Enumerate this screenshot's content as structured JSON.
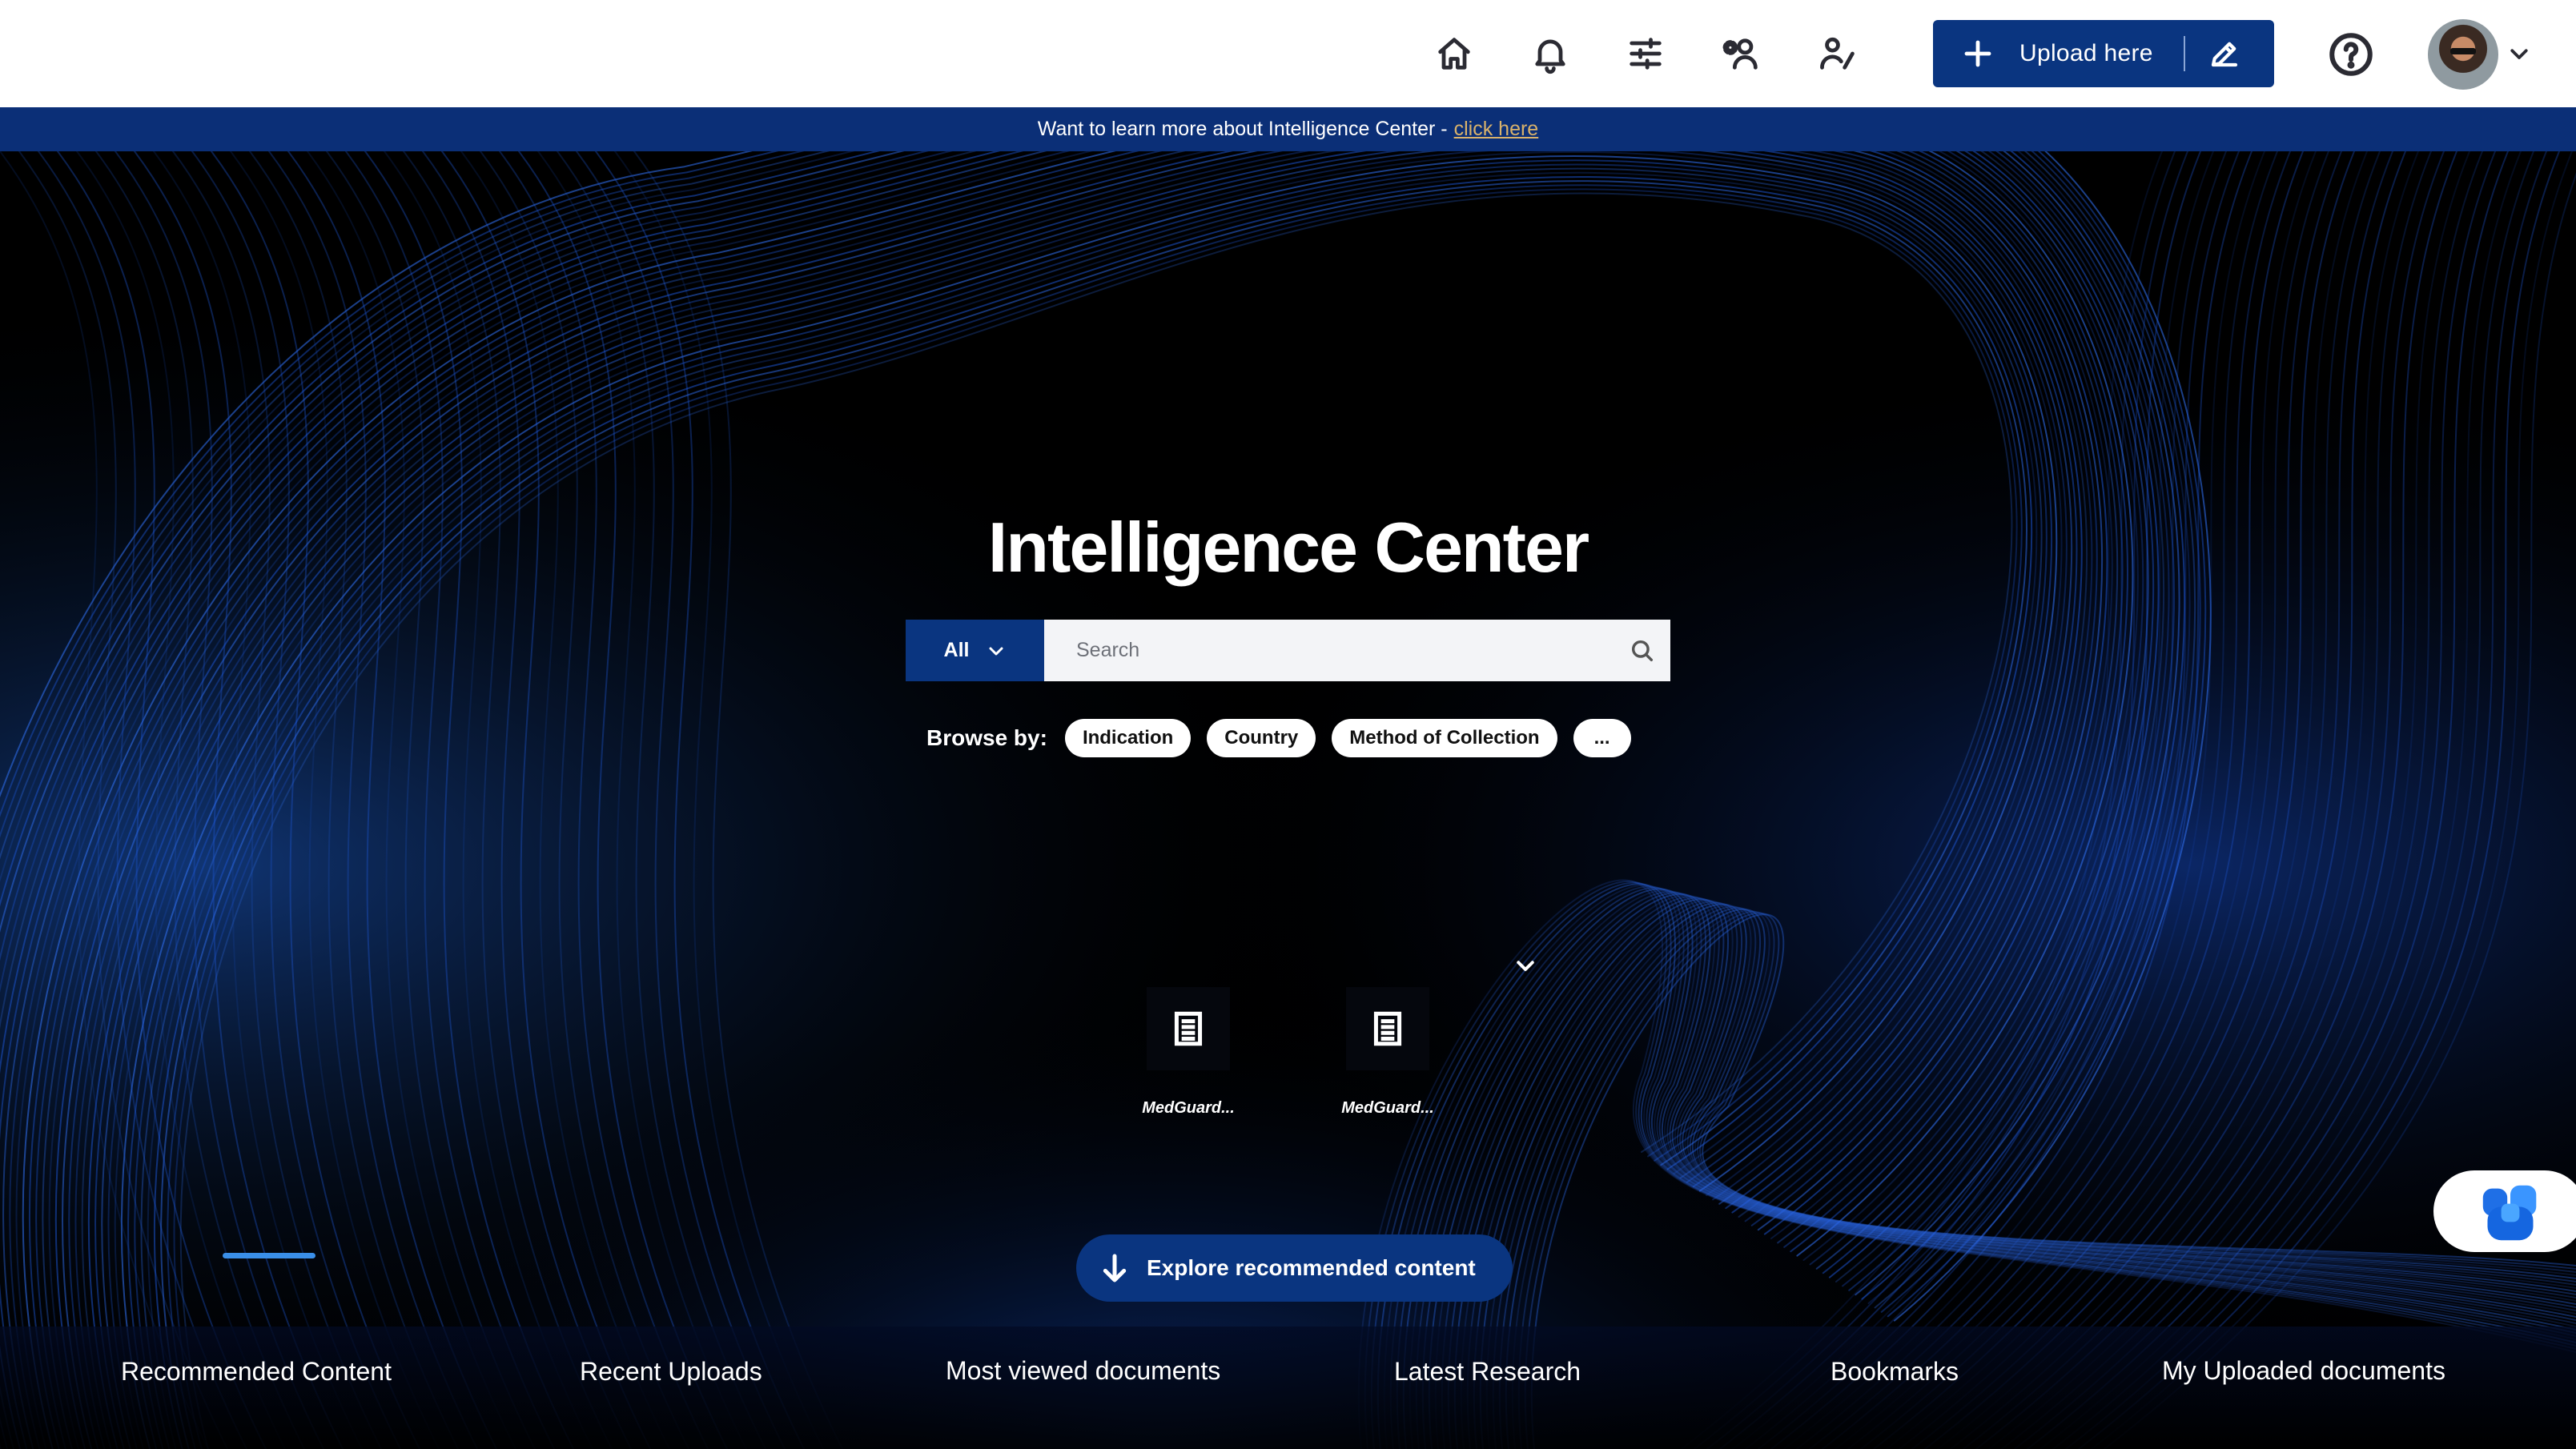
{
  "header": {
    "nav_icons": [
      "home-icon",
      "bell-icon",
      "sliders-icon",
      "people-settings-icon",
      "person-edit-icon"
    ],
    "upload_label": "Upload here",
    "help_icon": "question-circle-icon"
  },
  "banner": {
    "text": "Want to learn more about Intelligence Center -",
    "link": "click here"
  },
  "hero": {
    "title": "Intelligence Center",
    "search": {
      "scope": "All",
      "placeholder": "Search"
    },
    "browse": {
      "label": "Browse by:",
      "chips": [
        "Indication",
        "Country",
        "Method of Collection",
        "..."
      ]
    },
    "documents": [
      {
        "name": "MedGuard...",
        "icon": "document-icon"
      },
      {
        "name": "MedGuard...",
        "icon": "document-icon"
      }
    ],
    "explore_label": "Explore recommended content"
  },
  "tabs": {
    "items": [
      "Recommended Content",
      "Recent Uploads",
      "Most viewed documents",
      "Latest Research",
      "Bookmarks",
      "My Uploaded documents"
    ],
    "active": "Recommended Content"
  },
  "colors": {
    "brand_blue": "#0a3580",
    "banner_blue": "#0b2f77",
    "link_gold": "#d9b26b",
    "active_tab_underline": "#3a8fe8"
  }
}
